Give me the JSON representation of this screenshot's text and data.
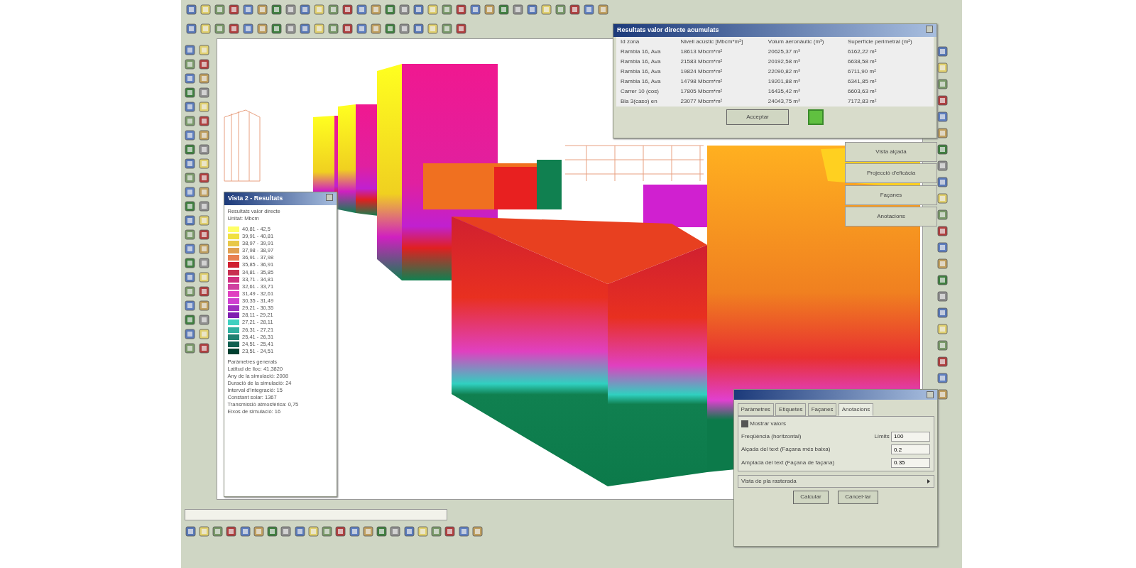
{
  "results_dialog": {
    "title": "Resultats valor directe acumulats",
    "columns": [
      "Id zona",
      "Nivell acústic [Mbcm*m²]",
      "Volum aeronàutic (m³)",
      "Superfície perimetral (m²)"
    ],
    "rows": [
      [
        "Rambla 16, Ava",
        "18613 Mbcm*m²",
        "20625,37 m³",
        "6162,22 m²"
      ],
      [
        "Rambla 16, Ava",
        "21583 Mbcm*m²",
        "20192,58 m³",
        "6638,58 m²"
      ],
      [
        "Rambla 16, Ava",
        "19824 Mbcm*m²",
        "22090,82 m³",
        "6711,90 m²"
      ],
      [
        "Rambla 16, Ava",
        "14798 Mbcm*m²",
        "19201,88 m³",
        "6341,85 m²"
      ],
      [
        "Carrer 10 (cos)",
        "17805 Mbcm*m²",
        "16435,42 m³",
        "6603,63 m²"
      ],
      [
        "Bla 3(caso) en",
        "23077 Mbcm*m²",
        "24043,75 m³",
        "7172,83 m²"
      ]
    ],
    "accept": "Acceptar"
  },
  "side_buttons": [
    "Vista alçada",
    "Projecció d'eficàcia",
    "Façanes",
    "Anotacions"
  ],
  "legend": {
    "title": "Vista 2 - Resultats",
    "heading": "Resultats valor directe",
    "unit": "Unitat: Mbcm",
    "items": [
      {
        "label": "40,81 - 42,5",
        "color": "#ffff66"
      },
      {
        "label": "39,91 - 40,81",
        "color": "#f0e040"
      },
      {
        "label": "38,97 - 39,91",
        "color": "#e8c848"
      },
      {
        "label": "37,98 - 38,97",
        "color": "#e0a050"
      },
      {
        "label": "36,91 - 37,98",
        "color": "#e88050"
      },
      {
        "label": "35,85 - 36,91",
        "color": "#d02030"
      },
      {
        "label": "34,81 - 35,85",
        "color": "#c83050"
      },
      {
        "label": "33,71 - 34,81",
        "color": "#d03080"
      },
      {
        "label": "32,61 - 33,71",
        "color": "#d040a0"
      },
      {
        "label": "31,49 - 32,61",
        "color": "#e040c0"
      },
      {
        "label": "30,35 - 31,49",
        "color": "#d040d0"
      },
      {
        "label": "29,21 - 30,35",
        "color": "#a030c0"
      },
      {
        "label": "28,11 - 29,21",
        "color": "#8020b0"
      },
      {
        "label": "27,21 - 28,11",
        "color": "#40d0c0"
      },
      {
        "label": "26,31 - 27,21",
        "color": "#30b0a0"
      },
      {
        "label": "25,41 - 26,31",
        "color": "#208070"
      },
      {
        "label": "24,51 - 25,41",
        "color": "#106050"
      },
      {
        "label": "23,51 - 24,51",
        "color": "#004030"
      }
    ],
    "stats": [
      "Paràmetres generals",
      "Latitud de lloc: 41,3820",
      "Any de la simulació: 2008",
      "Duració de la simulació: 24",
      "Interval d'integració: 15",
      "Constant solar: 1367",
      "Transmissió atmosfèrica: 0,75",
      "Eixos de simulació: 16"
    ]
  },
  "calc_dialog": {
    "tabs": [
      {
        "label": "Paràmetres",
        "selected": false
      },
      {
        "label": "Etiquetes",
        "selected": false
      },
      {
        "label": "Façanes",
        "selected": false
      },
      {
        "label": "Anotacions",
        "selected": true
      }
    ],
    "show_values": {
      "label": "Mostrar valors",
      "checked": true
    },
    "fields": [
      {
        "label": "Freqüència (horitzontal)",
        "unit": "Límits",
        "value": "100"
      },
      {
        "label": "Alçada del text (Façana més baixa)",
        "value": "0.2"
      },
      {
        "label": "Amplada del text (Façana de façana)",
        "value": "0.35"
      }
    ],
    "view": "Vista de pla rasterada",
    "buttons": [
      "Calcular",
      "Cancel·lar"
    ]
  }
}
